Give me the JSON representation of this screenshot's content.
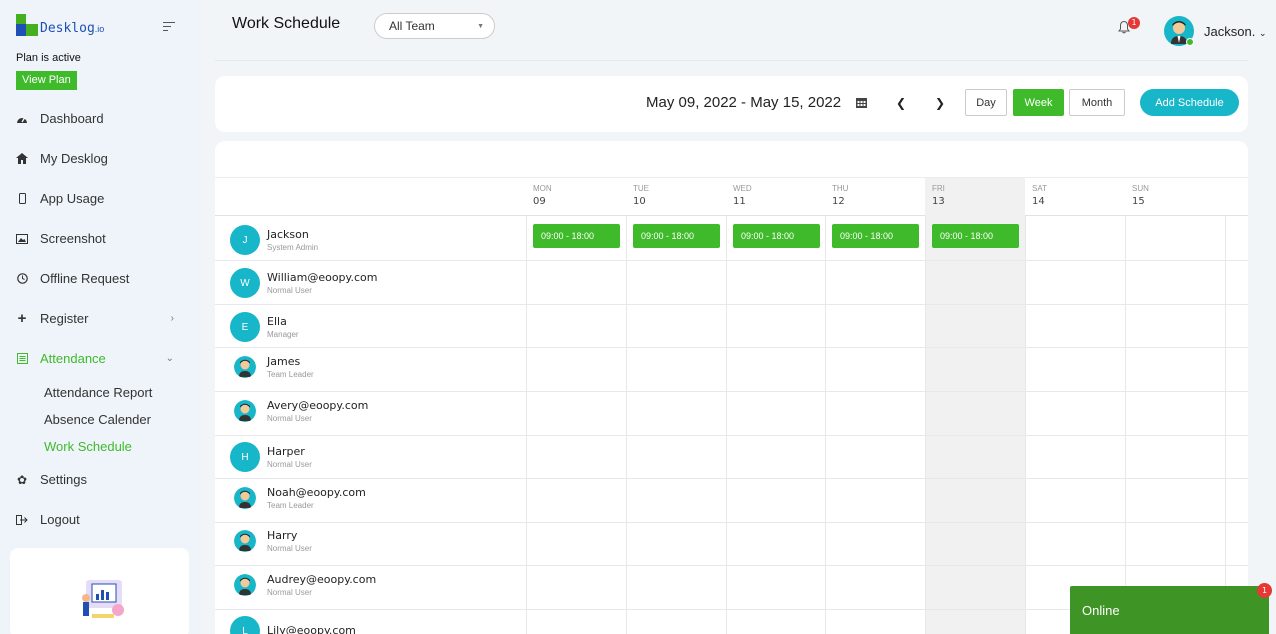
{
  "sidebar": {
    "logo_text": "Desklog",
    "logo_suffix": ".io",
    "plan_status": "Plan is active",
    "view_plan_label": "View Plan",
    "nav": [
      {
        "label": "Dashboard",
        "icon": "tachometer-icon"
      },
      {
        "label": "My Desklog",
        "icon": "home-icon"
      },
      {
        "label": "App Usage",
        "icon": "mobile-icon"
      },
      {
        "label": "Screenshot",
        "icon": "image-icon"
      },
      {
        "label": "Offline Request",
        "icon": "clock-icon"
      },
      {
        "label": "Register",
        "icon": "plus-icon"
      },
      {
        "label": "Attendance",
        "icon": "calendar-list-icon"
      },
      {
        "label": "Settings",
        "icon": "gear-icon"
      },
      {
        "label": "Logout",
        "icon": "logout-icon"
      }
    ],
    "attendance_sub": [
      "Attendance Report",
      "Absence Calender",
      "Work Schedule"
    ]
  },
  "header": {
    "title": "Work Schedule",
    "team_filter": "All Team",
    "notification_count": "1",
    "user_name": "Jackson."
  },
  "toolbar": {
    "date_range": "May 09, 2022 - May 15, 2022",
    "views": [
      "Day",
      "Week",
      "Month"
    ],
    "active_view": "Week",
    "add_label": "Add Schedule"
  },
  "schedule": {
    "days": [
      {
        "dow": "MON",
        "date": "09"
      },
      {
        "dow": "TUE",
        "date": "10"
      },
      {
        "dow": "WED",
        "date": "11"
      },
      {
        "dow": "THU",
        "date": "12"
      },
      {
        "dow": "FRI",
        "date": "13"
      },
      {
        "dow": "SAT",
        "date": "14"
      },
      {
        "dow": "SUN",
        "date": "15"
      }
    ],
    "employees": [
      {
        "name": "Jackson",
        "role": "System Admin",
        "initial": "J",
        "avatar": "letter",
        "shifts": [
          "09:00 - 18:00",
          "09:00 - 18:00",
          "09:00 - 18:00",
          "09:00 - 18:00",
          "09:00 - 18:00",
          "",
          ""
        ]
      },
      {
        "name": "William@eoopy.com",
        "role": "Normal User",
        "initial": "W",
        "avatar": "letter"
      },
      {
        "name": "Ella",
        "role": "Manager",
        "initial": "E",
        "avatar": "letter"
      },
      {
        "name": "James",
        "role": "Team Leader",
        "initial": "",
        "avatar": "photo"
      },
      {
        "name": "Avery@eoopy.com",
        "role": "Normal User",
        "initial": "",
        "avatar": "photo"
      },
      {
        "name": "Harper",
        "role": "Normal User",
        "initial": "H",
        "avatar": "letter"
      },
      {
        "name": "Noah@eoopy.com",
        "role": "Team Leader",
        "initial": "",
        "avatar": "photo"
      },
      {
        "name": "Harry",
        "role": "Normal User",
        "initial": "",
        "avatar": "photo"
      },
      {
        "name": "Audrey@eoopy.com",
        "role": "Normal User",
        "initial": "",
        "avatar": "photo"
      },
      {
        "name": "Lily@eoopy.com",
        "role": "",
        "initial": "L",
        "avatar": "letter"
      }
    ]
  },
  "chat": {
    "status": "Online",
    "badge": "1"
  },
  "colors": {
    "accent_green": "#3fba2b",
    "accent_teal": "#17b6c9",
    "brand_blue": "#1f4fb5"
  }
}
